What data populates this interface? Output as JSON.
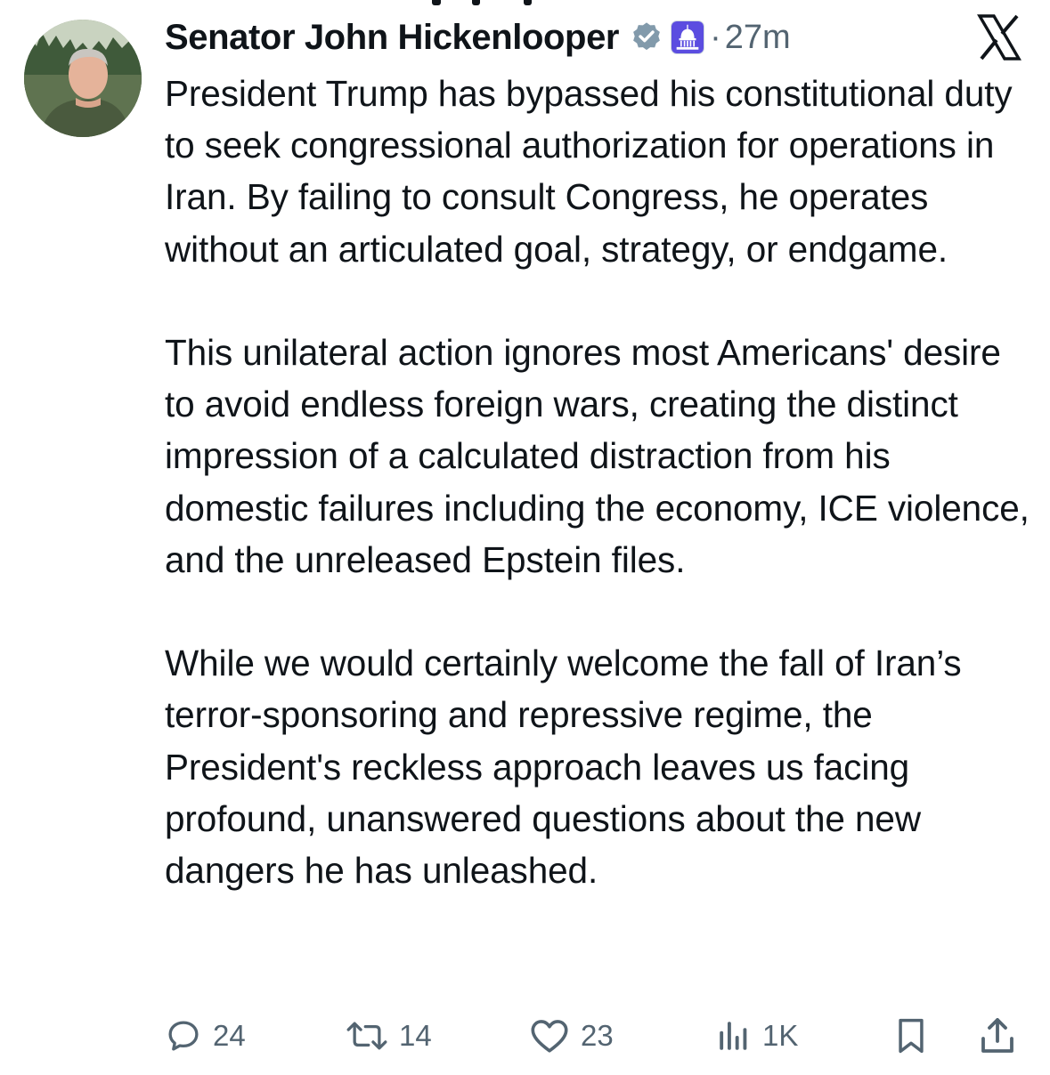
{
  "tweet": {
    "author": {
      "display_name": "Senator John Hickenlooper",
      "verified_icon": "verified-badge-icon",
      "affiliation_icon": "capitol-dome-icon"
    },
    "separator": "·",
    "timestamp": "27m",
    "paragraphs": [
      "President Trump has bypassed his constitutional duty to seek congressional authorization for operations in Iran. By failing to consult Congress, he operates without an articulated goal, strategy, or endgame.",
      "This unilateral action ignores most Americans' desire to avoid endless foreign wars, creating the distinct impression of a calculated distraction from his domestic failures including the economy, ICE violence, and the unreleased Epstein files.",
      "While we would certainly welcome the fall of Iran’s terror-sponsoring and repressive regime, the President's reckless approach leaves us facing profound, unanswered questions about the new dangers he has unleashed."
    ],
    "actions": {
      "replies": "24",
      "reposts": "14",
      "likes": "23",
      "views": "1K"
    }
  },
  "colors": {
    "text": "#0f1419",
    "secondary": "#536471",
    "verified": "#829aab",
    "affiliation_bg": "#5b4de0"
  }
}
